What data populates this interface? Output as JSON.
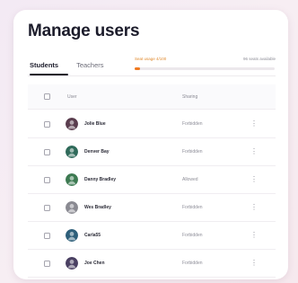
{
  "title": "Manage users",
  "tabs": [
    {
      "label": "Students",
      "active": true
    },
    {
      "label": "Teachers",
      "active": false
    }
  ],
  "usage": {
    "left_text": "Seat usage 4/100",
    "right_text": "96 seats available",
    "fraction": 0.04,
    "color": "#f07a20"
  },
  "table": {
    "headers": {
      "user": "User",
      "sharing": "Sharing"
    },
    "rows": [
      {
        "name": "Jolie Blue",
        "sharing": "Forbidden",
        "avatar_icon": "user-avatar-icon",
        "avatar_color": "#5a3d4e"
      },
      {
        "name": "Denver Bay",
        "sharing": "Forbidden",
        "avatar_icon": "user-avatar-icon",
        "avatar_color": "#2f6a5a"
      },
      {
        "name": "Danny Bradley",
        "sharing": "Allowed",
        "avatar_icon": "user-avatar-icon",
        "avatar_color": "#3d7a52"
      },
      {
        "name": "Wes Bradley",
        "sharing": "Forbidden",
        "avatar_icon": "user-avatar-icon",
        "avatar_color": "#8a8a92"
      },
      {
        "name": "Carla55",
        "sharing": "Forbidden",
        "avatar_icon": "user-avatar-icon",
        "avatar_color": "#2e5f7a"
      },
      {
        "name": "Joe Chen",
        "sharing": "Forbidden",
        "avatar_icon": "user-avatar-icon",
        "avatar_color": "#4a4062"
      }
    ],
    "more_icon": "more-vertical-icon",
    "more_glyph": "⋮"
  }
}
